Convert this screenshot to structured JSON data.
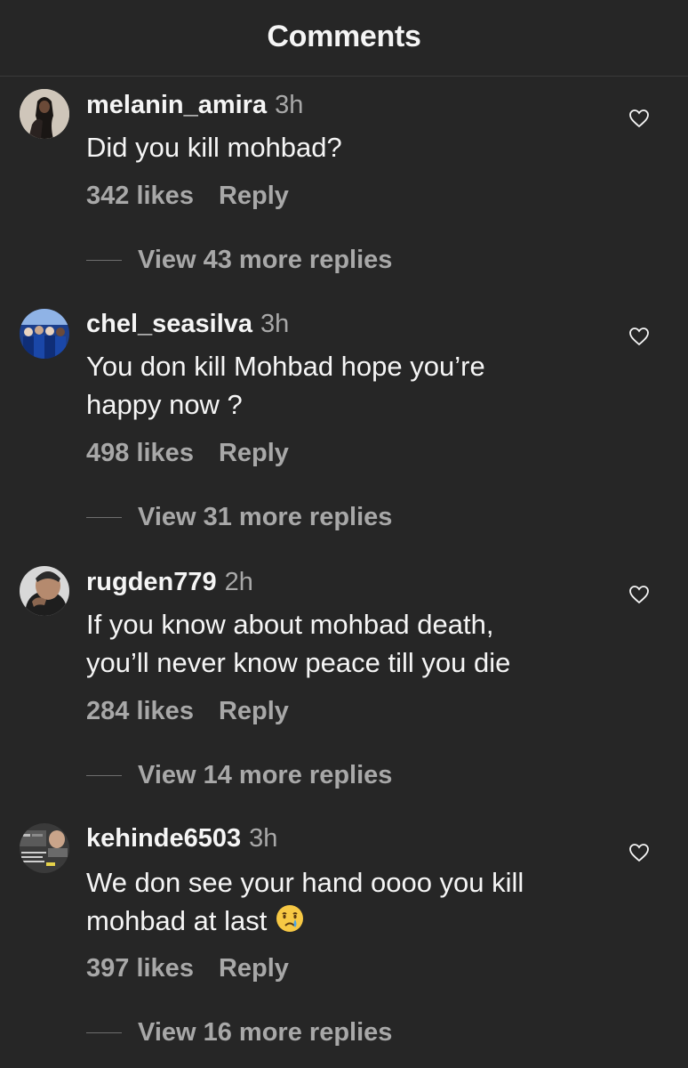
{
  "header": {
    "title": "Comments"
  },
  "comments": [
    {
      "username": "melanin_amira",
      "time": "3h",
      "text_lines": [
        "Did you kill mohbad?"
      ],
      "likes": "342 likes",
      "reply": "Reply",
      "view_replies": "View 43 more replies",
      "avatar_icon": "woman-photo-avatar"
    },
    {
      "username": "chel_seasilva",
      "time": "3h",
      "text_lines": [
        "You don kill Mohbad hope you’re",
        "happy now ?"
      ],
      "likes": "498 likes",
      "reply": "Reply",
      "view_replies": "View 31 more replies",
      "avatar_icon": "football-team-avatar"
    },
    {
      "username": "rugden779",
      "time": "2h",
      "text_lines": [
        "If you know about mohbad death,",
        "you’ll never know peace till you die"
      ],
      "likes": "284 likes",
      "reply": "Reply",
      "view_replies": "View 14 more replies",
      "avatar_icon": "man-photo-avatar"
    },
    {
      "username": "kehinde6503",
      "time": "3h",
      "text_lines": [
        "We don see your hand oooo you kill",
        "mohbad at last"
      ],
      "emoji": "crying-face-emoji",
      "likes": "397 likes",
      "reply": "Reply",
      "view_replies": "View 16 more replies",
      "avatar_icon": "screenshot-collage-avatar"
    }
  ],
  "colors": {
    "background": "#262626",
    "primary_text": "#f5f5f5",
    "secondary_text": "#a8a8a8"
  }
}
